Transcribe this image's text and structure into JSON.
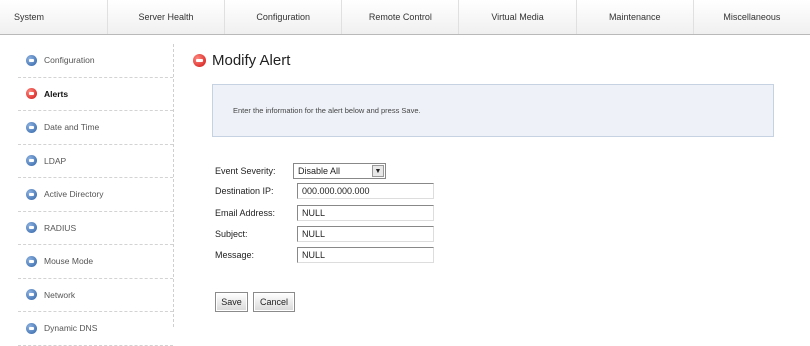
{
  "topnav": {
    "items": [
      "System",
      "Server Health",
      "Configuration",
      "Remote Control",
      "Virtual Media",
      "Maintenance",
      "Miscellaneous"
    ]
  },
  "sidebar": {
    "items": [
      {
        "label": "Configuration"
      },
      {
        "label": "Alerts"
      },
      {
        "label": "Date and Time"
      },
      {
        "label": "LDAP"
      },
      {
        "label": "Active Directory"
      },
      {
        "label": "RADIUS"
      },
      {
        "label": "Mouse Mode"
      },
      {
        "label": "Network"
      },
      {
        "label": "Dynamic DNS"
      }
    ],
    "active_index": 1
  },
  "main": {
    "title": "Modify Alert",
    "info_text": "Enter the information for the alert below and press Save.",
    "form": {
      "event_severity": {
        "label": "Event Severity:",
        "value": "Disable All"
      },
      "destination_ip": {
        "label": "Destination IP:",
        "value": "000.000.000.000"
      },
      "email_address": {
        "label": "Email Address:",
        "value": "NULL"
      },
      "subject": {
        "label": "Subject:",
        "value": "NULL"
      },
      "message": {
        "label": "Message:",
        "value": "NULL"
      }
    },
    "buttons": {
      "save": "Save",
      "cancel": "Cancel"
    }
  },
  "colors": {
    "active_icon": "#d01010",
    "nav_icon": "#2e63a8",
    "info_box_bg": "#eef2f8"
  }
}
